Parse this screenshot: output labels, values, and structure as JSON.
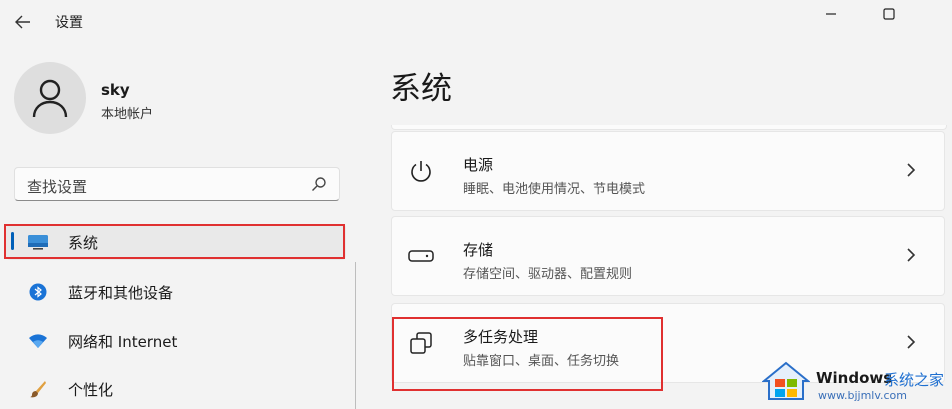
{
  "app": {
    "title": "设置"
  },
  "user": {
    "name": "sky",
    "account_type": "本地帐户"
  },
  "search": {
    "placeholder": "查找设置"
  },
  "nav": {
    "items": [
      {
        "label": "系统",
        "icon": "monitor-icon",
        "selected": true
      },
      {
        "label": "蓝牙和其他设备",
        "icon": "bluetooth-icon"
      },
      {
        "label": "网络和 Internet",
        "icon": "wifi-icon"
      },
      {
        "label": "个性化",
        "icon": "brush-icon"
      }
    ]
  },
  "main": {
    "title": "系统",
    "cards": [
      {
        "title": "电源",
        "subtitle": "睡眠、电池使用情况、节电模式",
        "icon": "power-icon"
      },
      {
        "title": "存储",
        "subtitle": "存储空间、驱动器、配置规则",
        "icon": "storage-icon"
      },
      {
        "title": "多任务处理",
        "subtitle": "贴靠窗口、桌面、任务切换",
        "icon": "multitasking-icon"
      }
    ]
  },
  "watermark": {
    "brand": "Windows",
    "site": "系统之家",
    "url": "www.bjjmlv.com"
  },
  "colors": {
    "accent": "#005fb8",
    "highlight": "#e03030",
    "background": "#f3f3f3"
  }
}
